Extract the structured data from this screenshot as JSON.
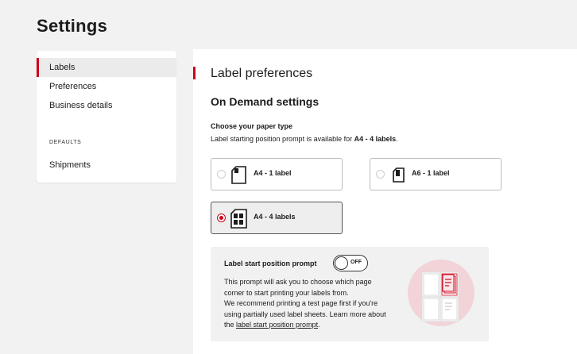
{
  "page": {
    "title": "Settings"
  },
  "sidebar": {
    "items": [
      {
        "label": "Labels",
        "active": true
      },
      {
        "label": "Preferences"
      },
      {
        "label": "Business details"
      }
    ],
    "defaults_heading": "DEFAULTS",
    "defaults_items": [
      {
        "label": "Shipments"
      }
    ]
  },
  "main": {
    "title": "Label preferences",
    "section": "On Demand settings",
    "paper": {
      "heading": "Choose your paper type",
      "desc_prefix": "Label starting position prompt is available for ",
      "desc_bold": "A4 - 4 labels",
      "desc_suffix": ".",
      "options": [
        {
          "label": "A4 - 1 label",
          "selected": false,
          "icon": "a4-single-label-icon"
        },
        {
          "label": "A6 - 1 label",
          "selected": false,
          "icon": "a6-single-label-icon"
        },
        {
          "label": "A4 - 4 labels",
          "selected": true,
          "icon": "a4-four-labels-icon"
        }
      ]
    },
    "prompt": {
      "title": "Label start position prompt",
      "toggle_text": "OFF",
      "toggle_on": false,
      "lines": [
        "This prompt will ask you to choose which page",
        "corner to start printing your labels from.",
        "We recommend printing a test page first if you're",
        "using partially used label sheets. Learn more about"
      ],
      "last_prefix": "the ",
      "link_text": "label start position prompt",
      "last_suffix": "."
    }
  },
  "colors": {
    "accent": "#d0021b",
    "page_bg": "#f2f2f2",
    "illustration_circle": "#f2d4d8"
  }
}
